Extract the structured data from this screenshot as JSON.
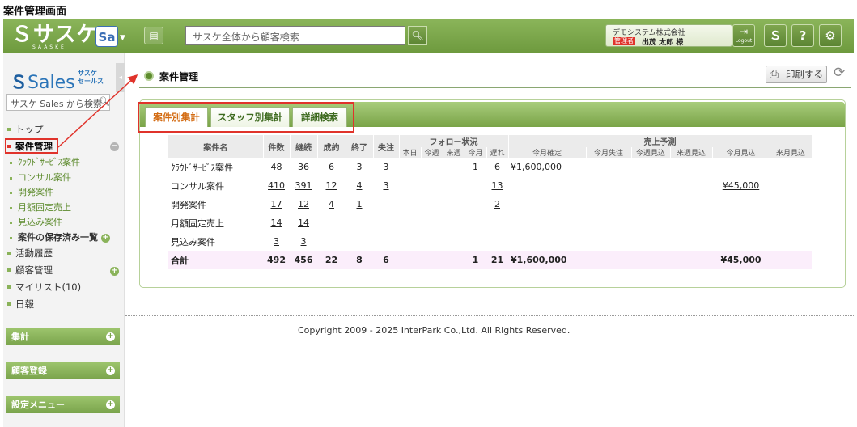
{
  "doc_title": "案件管理画面",
  "header": {
    "logo": "サスケ",
    "logo_sub": "SAASKE",
    "app_icon": "Sa",
    "search_placeholder": "サスケ全体から顧客検索",
    "company": "デモシステム株式会社",
    "admin_badge": "管理者",
    "user_name": "出茂 太郎 様",
    "logout_label": "Logout",
    "icons": [
      "chat-icon",
      "search-icon",
      "logout-icon",
      "saaske-s-icon",
      "help-icon",
      "gear-icon"
    ]
  },
  "sidebar": {
    "logo": "Sales",
    "logo_sub_1": "サスケ",
    "logo_sub_2": "セールス",
    "search_placeholder": "サスケ Sales から検索",
    "nav_top": "トップ",
    "nav_active": "案件管理",
    "sub_items": [
      "ｸﾗｳﾄﾞｻｰﾋﾞｽ案件",
      "コンサル案件",
      "開発案件",
      "月額固定売上",
      "見込み案件"
    ],
    "saved_list": "案件の保存済み一覧",
    "nav_rest": [
      "活動履歴",
      "顧客管理",
      "マイリスト(10)",
      "日報"
    ],
    "sections": [
      "集計",
      "顧客登録",
      "設定メニュー"
    ]
  },
  "main": {
    "title": "案件管理",
    "print_label": "印刷する",
    "tabs": [
      "案件別集計",
      "スタッフ別集計",
      "詳細検索"
    ],
    "table": {
      "headers": {
        "name": "案件名",
        "count": "件数",
        "ongoing": "継続",
        "won": "成約",
        "closed": "終了",
        "lost": "失注",
        "follow": "フォロー状況",
        "forecast": "売上予測"
      },
      "follow_sub": [
        "本日",
        "今週",
        "来週",
        "今月",
        "遅れ"
      ],
      "forecast_sub": [
        "今月確定",
        "今月失注",
        "今週見込",
        "来週見込",
        "今月見込",
        "来月見込"
      ],
      "rows": [
        {
          "name": "ｸﾗｳﾄﾞｻｰﾋﾞｽ案件",
          "count": "48",
          "ongoing": "36",
          "won": "6",
          "closed": "3",
          "lost": "3",
          "today": "",
          "week": "",
          "next_week": "",
          "month": "1",
          "late": "6",
          "month_fixed": "¥1,600,000",
          "month_lost": "",
          "week_est": "",
          "next_week_est": "",
          "month_est": "",
          "next_month_est": ""
        },
        {
          "name": "コンサル案件",
          "count": "410",
          "ongoing": "391",
          "won": "12",
          "closed": "4",
          "lost": "3",
          "today": "",
          "week": "",
          "next_week": "",
          "month": "",
          "late": "13",
          "month_fixed": "",
          "month_lost": "",
          "week_est": "",
          "next_week_est": "",
          "month_est": "¥45,000",
          "next_month_est": ""
        },
        {
          "name": "開発案件",
          "count": "17",
          "ongoing": "12",
          "won": "4",
          "closed": "1",
          "lost": "",
          "today": "",
          "week": "",
          "next_week": "",
          "month": "",
          "late": "2",
          "month_fixed": "",
          "month_lost": "",
          "week_est": "",
          "next_week_est": "",
          "month_est": "",
          "next_month_est": ""
        },
        {
          "name": "月額固定売上",
          "count": "14",
          "ongoing": "14",
          "won": "",
          "closed": "",
          "lost": "",
          "today": "",
          "week": "",
          "next_week": "",
          "month": "",
          "late": "",
          "month_fixed": "",
          "month_lost": "",
          "week_est": "",
          "next_week_est": "",
          "month_est": "",
          "next_month_est": ""
        },
        {
          "name": "見込み案件",
          "count": "3",
          "ongoing": "3",
          "won": "",
          "closed": "",
          "lost": "",
          "today": "",
          "week": "",
          "next_week": "",
          "month": "",
          "late": "",
          "month_fixed": "",
          "month_lost": "",
          "week_est": "",
          "next_week_est": "",
          "month_est": "",
          "next_month_est": ""
        }
      ],
      "total": {
        "name": "合計",
        "count": "492",
        "ongoing": "456",
        "won": "22",
        "closed": "8",
        "lost": "6",
        "today": "",
        "week": "",
        "next_week": "",
        "month": "1",
        "late": "21",
        "month_fixed": "¥1,600,000",
        "month_lost": "",
        "week_est": "",
        "next_week_est": "",
        "month_est": "¥45,000",
        "next_month_est": ""
      }
    }
  },
  "footer": {
    "copyright": "Copyright 2009 - 2025 InterPark Co.,Ltd. All Rights Reserved."
  },
  "colors": {
    "brand_green": "#7aa44c",
    "annotation_red": "#e0332b",
    "active_tab_text": "#d36b12"
  }
}
